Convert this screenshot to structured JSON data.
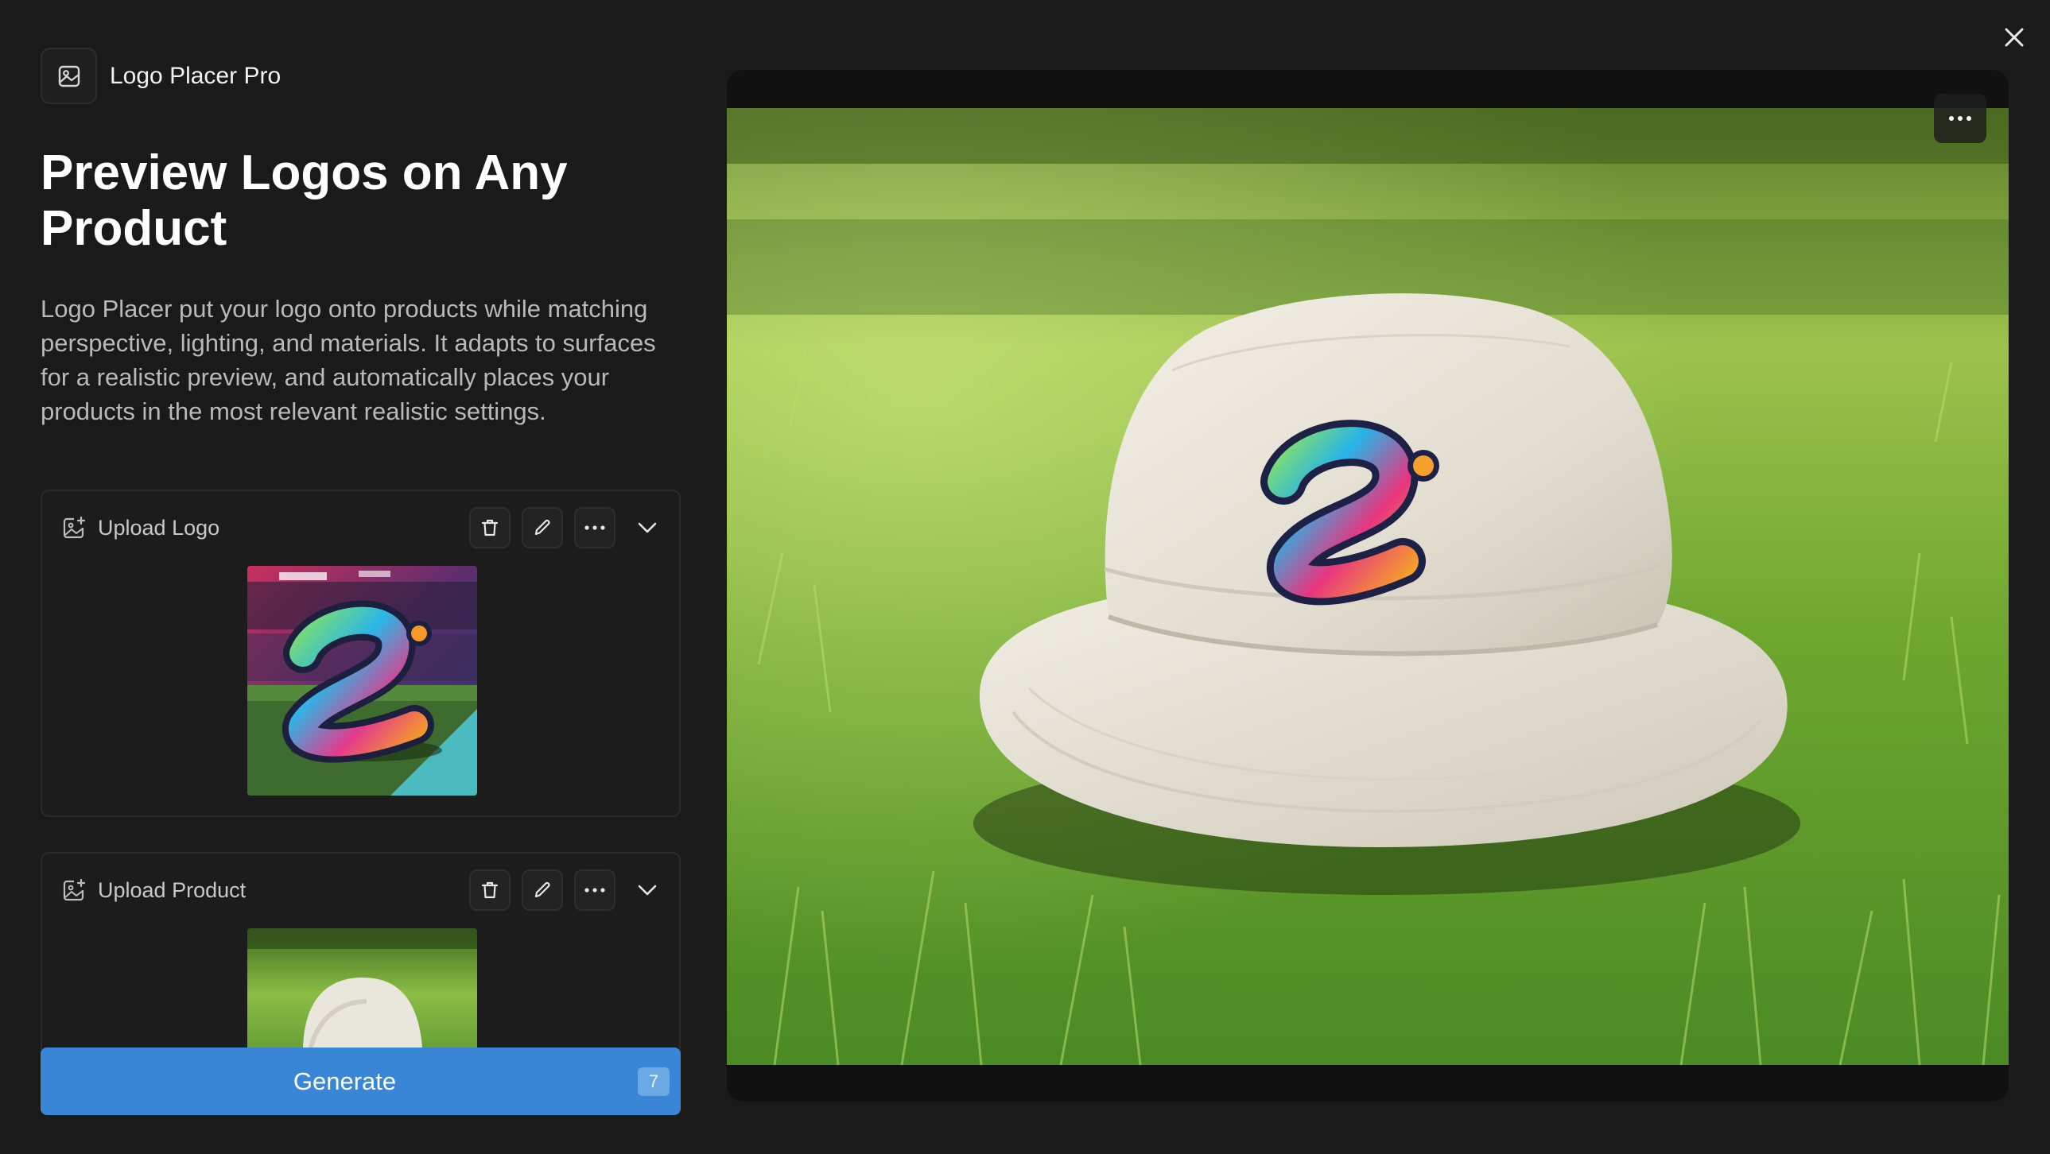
{
  "app": {
    "name": "Logo Placer Pro",
    "icon": "image-icon"
  },
  "page": {
    "title": "Preview Logos on Any Product",
    "description": "Logo Placer put your logo onto products while matching perspective, lighting, and materials. It adapts to surfaces for a realistic preview, and automatically places your products in the most relevant realistic settings."
  },
  "sections": {
    "logo": {
      "label": "Upload Logo",
      "icon": "image-add-icon"
    },
    "product": {
      "label": "Upload Product",
      "icon": "image-add-icon"
    }
  },
  "actions": {
    "delete_icon": "trash-icon",
    "edit_icon": "pencil-icon",
    "more_icon": "more-horizontal-icon",
    "expand_icon": "chevron-down-icon"
  },
  "generate": {
    "label": "Generate",
    "count": "7"
  },
  "colors": {
    "background": "#1a1a1a",
    "accent": "#3a86d6"
  }
}
